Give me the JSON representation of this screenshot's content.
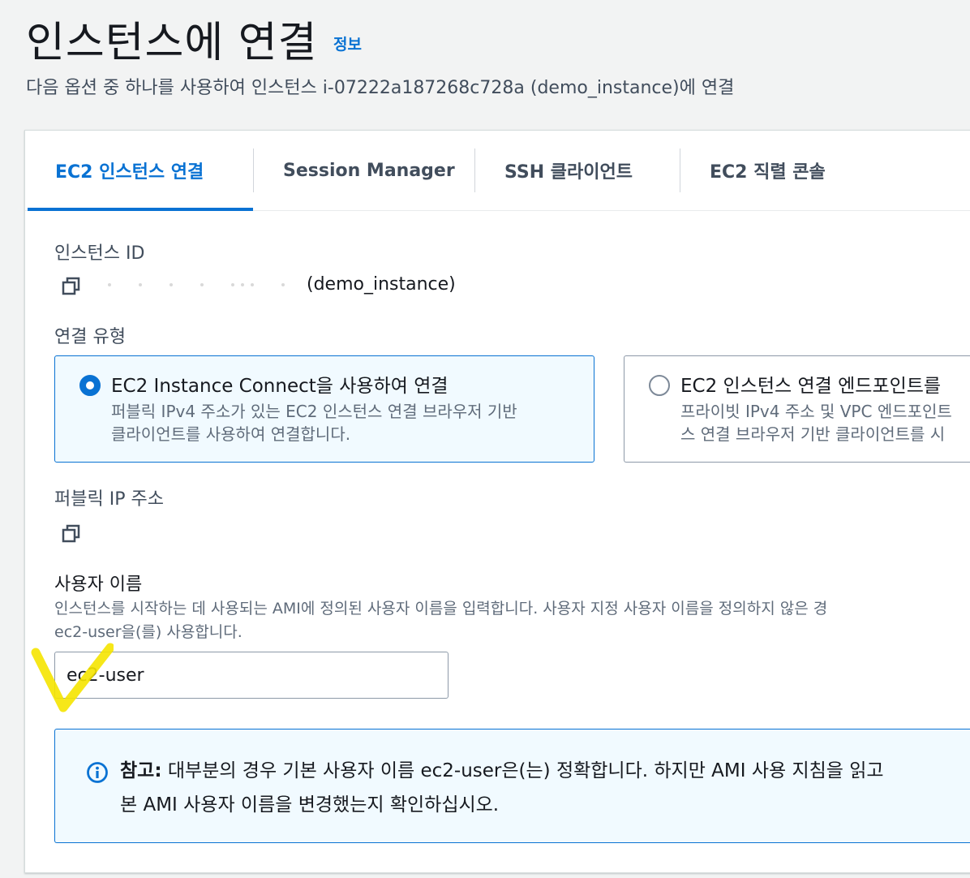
{
  "header": {
    "title": "인스턴스에 연결",
    "info_link": "정보",
    "subtitle": "다음 옵션 중 하나를 사용하여 인스턴스 i-07222a187268c728a (demo_instance)에 연결"
  },
  "tabs": [
    {
      "label": "EC2 인스턴스 연결",
      "active": true
    },
    {
      "label": "Session Manager",
      "active": false
    },
    {
      "label": "SSH 클라이언트",
      "active": false
    },
    {
      "label": "EC2 직렬 콘솔",
      "active": false
    }
  ],
  "instance": {
    "label": "인스턴스 ID",
    "name_suffix": "(demo_instance)"
  },
  "connection_type": {
    "label": "연결 유형",
    "options": [
      {
        "title": "EC2 Instance Connect을 사용하여 연결",
        "desc_line1": "퍼블릭 IPv4 주소가 있는 EC2 인스턴스 연결 브라우저 기반",
        "desc_line2": "클라이언트를 사용하여 연결합니다.",
        "selected": true
      },
      {
        "title": "EC2 인스턴스 연결 엔드포인트를",
        "desc_line1": "프라이빗 IPv4 주소 및 VPC 엔드포인트",
        "desc_line2": "스 연결 브라우저 기반 클라이언트를 시",
        "selected": false
      }
    ]
  },
  "public_ip": {
    "label": "퍼블릭 IP 주소"
  },
  "username": {
    "label": "사용자 이름",
    "hint_line1": "인스턴스를 시작하는 데 사용되는 AMI에 정의된 사용자 이름을 입력합니다. 사용자 지정 사용자 이름을 정의하지 않은 경",
    "hint_line2": "ec2-user을(를) 사용합니다.",
    "value": "ec2-user"
  },
  "note": {
    "bold": "참고:",
    "line1": " 대부분의 경우 기본 사용자 이름 ec2-user은(는) 정확합니다. 하지만 AMI 사용 지침을 읽고",
    "line2": "본 AMI 사용자 이름을 변경했는지 확인하십시오."
  },
  "colors": {
    "accent": "#0972d3",
    "text": "#16191f",
    "muted": "#5f6b7a",
    "annotation": "#f5e400"
  }
}
